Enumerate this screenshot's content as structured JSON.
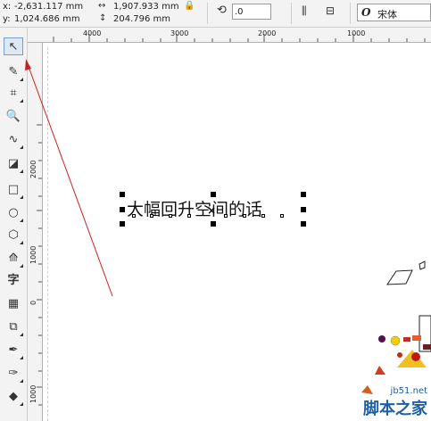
{
  "property_bar": {
    "x_label": "x:",
    "x_value": "-2,631.117 mm",
    "y_label": "y:",
    "y_value": "1,024.686 mm",
    "width_value": "1,907.933 mm",
    "height_value": "204.796 mm",
    "rotation_value": ".0",
    "font_name": "宋体",
    "font_icon_glyph": "O"
  },
  "ruler": {
    "h_labels": [
      "4000",
      "3000",
      "2000",
      "1000"
    ],
    "v_labels": [
      "2000",
      "1000",
      "0",
      "1000"
    ]
  },
  "canvas": {
    "text_object": "大幅回升空间的话"
  },
  "watermark": {
    "site": "jb51.net",
    "name": "脚本之家"
  },
  "colors": {
    "arrow": "#cc2020",
    "selection_handle": "#000000",
    "toolbar_bg": "#f3f3f3"
  },
  "tools": [
    "pick-tool",
    "shape-tool",
    "crop-tool",
    "zoom-tool",
    "freehand-tool",
    "smart-fill-tool",
    "rectangle-tool",
    "ellipse-tool",
    "polygon-tool",
    "basic-shapes-tool",
    "text-tool",
    "table-tool",
    "parallel-dimension-tool",
    "eyedropper-tool",
    "outline-pen-tool",
    "fill-tool"
  ]
}
